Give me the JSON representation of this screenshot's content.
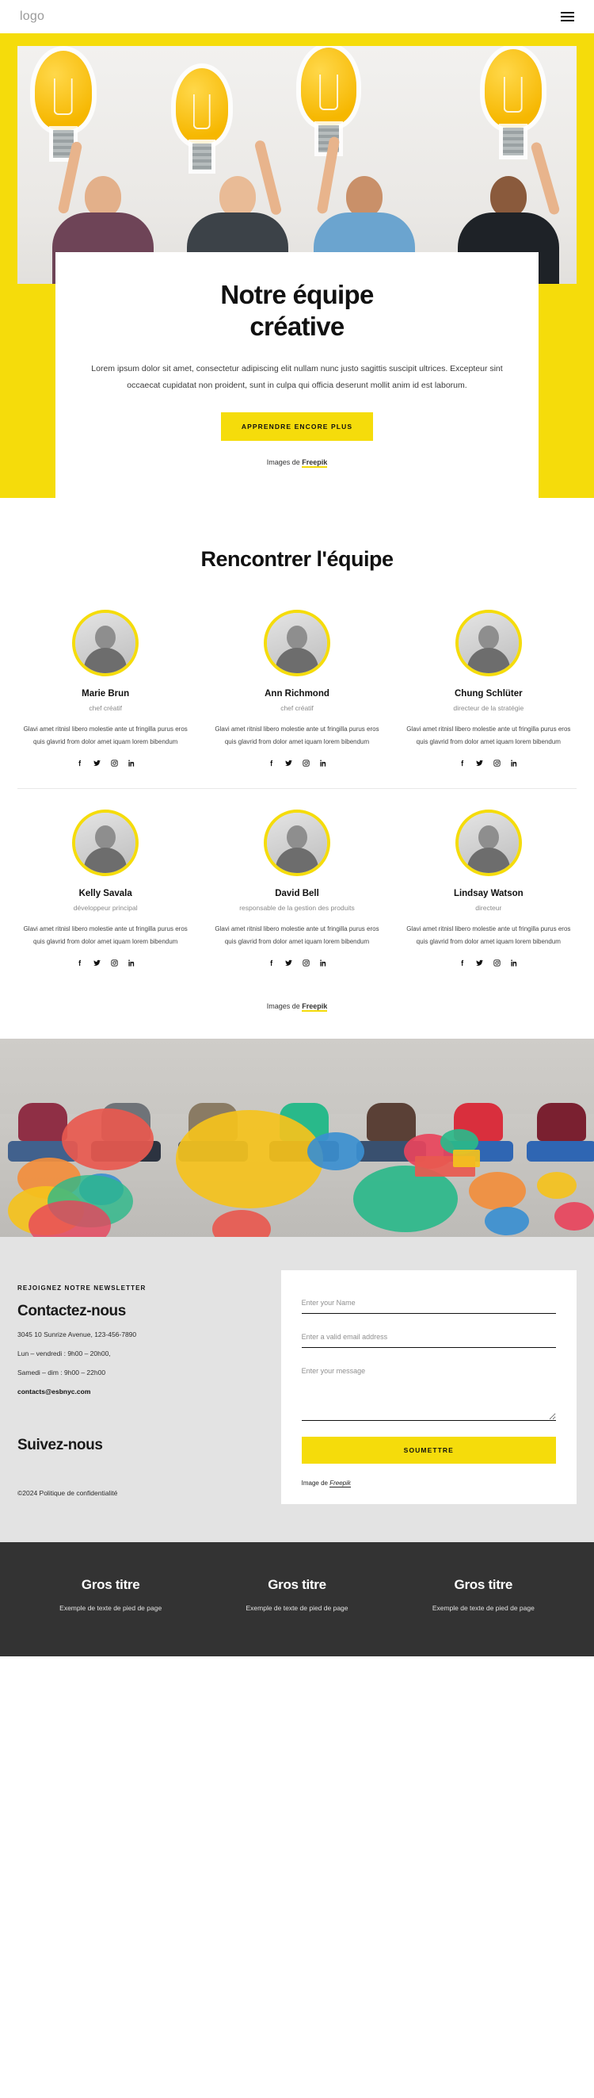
{
  "header": {
    "logo": "logo",
    "menu_icon": "hamburger-icon"
  },
  "hero": {
    "title_line1": "Notre équipe",
    "title_line2": "créative",
    "description": "Lorem ipsum dolor sit amet, consectetur adipiscing elit nullam nunc justo sagittis suscipit ultrices. Excepteur sint occaecat cupidatat non proident, sunt in culpa qui officia deserunt mollit anim id est laborum.",
    "cta_label": "APPRENDRE ENCORE PLUS",
    "credit_prefix": "Images de ",
    "credit_source": "Freepik"
  },
  "team": {
    "title": "Rencontrer l'équipe",
    "bio": "Glavi amet ritnisl libero molestie ante ut fringilla purus eros quis glavrid from dolor amet iquam lorem bibendum",
    "credit_prefix": "Images de ",
    "credit_source": "Freepik",
    "members": [
      {
        "name": "Marie Brun",
        "role": "chef créatif"
      },
      {
        "name": "Ann Richmond",
        "role": "chef créatif"
      },
      {
        "name": "Chung Schlüter",
        "role": "directeur de la stratégie"
      },
      {
        "name": "Kelly Savala",
        "role": "développeur principal"
      },
      {
        "name": "David Bell",
        "role": "responsable de la gestion des produits"
      },
      {
        "name": "Lindsay Watson",
        "role": "directeur"
      }
    ],
    "social_icons": [
      "facebook-icon",
      "twitter-icon",
      "instagram-icon",
      "linkedin-icon"
    ]
  },
  "contact": {
    "eyebrow": "REJOIGNEZ NOTRE NEWSLETTER",
    "heading": "Contactez-nous",
    "address": "3045 10 Sunrize Avenue, 123-456-7890",
    "hours_weekday": "Lun – vendredi : 9h00 – 20h00,",
    "hours_weekend": "Samedi – dim : 9h00 – 22h00",
    "email": "contacts@esbnyc.com",
    "follow_heading": "Suivez-nous",
    "copyright": "©2024 Politique de confidentialité",
    "form": {
      "name_placeholder": "Enter your Name",
      "email_placeholder": "Enter a valid email address",
      "message_placeholder": "Enter your message",
      "submit_label": "SOUMETTRE",
      "credit_prefix": "Image de ",
      "credit_source": "Freepik"
    }
  },
  "footer": {
    "columns": [
      {
        "title": "Gros titre",
        "text": "Exemple de texte de pied de page"
      },
      {
        "title": "Gros titre",
        "text": "Exemple de texte de pied de page"
      },
      {
        "title": "Gros titre",
        "text": "Exemple de texte de pied de page"
      }
    ]
  },
  "colors": {
    "accent_yellow": "#F5DC0B",
    "footer_dark": "#333333",
    "contact_grey": "#E3E3E3",
    "text_dark": "#111111",
    "text_muted": "#8A8A8A"
  }
}
